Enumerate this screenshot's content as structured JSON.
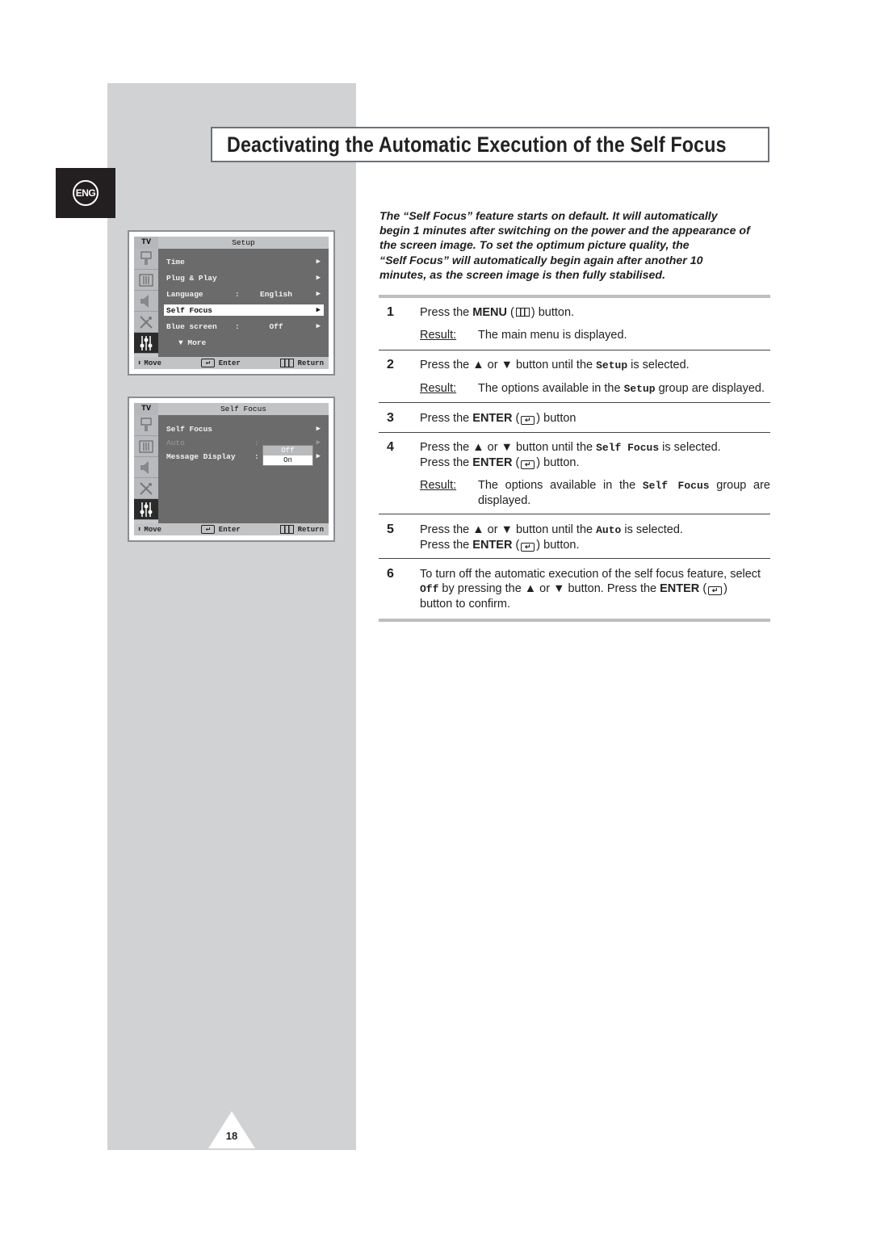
{
  "sidebar": {
    "language_badge": "ENG",
    "page_number": "18"
  },
  "header": {
    "title": "Deactivating the Automatic Execution of the Self Focus"
  },
  "screen1": {
    "tv_label": "TV",
    "title": "Setup",
    "rows": [
      {
        "label": "Time",
        "value": "",
        "arrow": "▶"
      },
      {
        "label": "Plug & Play",
        "value": "",
        "arrow": "▶"
      },
      {
        "label": "Language",
        "colon": ":",
        "value": "English",
        "arrow": "▶"
      },
      {
        "label": "Self Focus",
        "value": "",
        "arrow": "▶",
        "selected": true
      },
      {
        "label": "Blue screen",
        "colon": ":",
        "value": "Off",
        "arrow": "▶"
      },
      {
        "label": "▼ More",
        "value": ""
      }
    ],
    "footer": {
      "move": "Move",
      "enter": "Enter",
      "return": "Return"
    }
  },
  "screen2": {
    "tv_label": "TV",
    "title": "Self Focus",
    "rows": [
      {
        "label": "Self Focus",
        "arrow": "▶"
      },
      {
        "label": "Auto",
        "colon": ":",
        "arrow": "▶",
        "dimmed": true
      },
      {
        "label": "Message Display",
        "colon": ":",
        "arrow": "▶"
      }
    ],
    "dropdown": {
      "options": [
        "Off",
        "On"
      ],
      "highlighted": "Off"
    },
    "footer": {
      "move": "Move",
      "enter": "Enter",
      "return": "Return"
    }
  },
  "intro": {
    "lines": [
      "The “Self Focus” feature starts on default.  It will automatically",
      "begin 1 minutes after switching on the power and the appearance of",
      "the screen image. To set the optimum picture quality, the",
      "“Self Focus” will automatically begin again after another 10",
      "minutes, as the screen image is then fully stabilised."
    ]
  },
  "steps": [
    {
      "num": "1",
      "pre": "Press the ",
      "bold": "MENU",
      "post": " button.",
      "result_label": "Result:",
      "result": "The main menu is displayed."
    },
    {
      "num": "2",
      "pre": "Press the ▲ or ▼ button until the ",
      "code": "Setup",
      "post": " is selected.",
      "result_label": "Result:",
      "result_pre": "The options available in the ",
      "result_code": "Setup",
      "result_post": " group are displayed."
    },
    {
      "num": "3",
      "pre": "Press the ",
      "bold": "ENTER",
      "post": " button"
    },
    {
      "num": "4",
      "pre": "Press the ▲ or ▼ button until the ",
      "code": "Self Focus",
      "post": " is selected.",
      "line2_pre": "Press the ",
      "line2_bold": "ENTER",
      "line2_post": " button.",
      "result_label": "Result:",
      "result_pre": "The options available in the ",
      "result_code": "Self Focus",
      "result_post": " group are displayed."
    },
    {
      "num": "5",
      "pre": "Press the ▲ or ▼ button until the ",
      "code": "Auto",
      "post": " is selected.",
      "line2_pre": "Press the ",
      "line2_bold": "ENTER",
      "line2_post": " button."
    },
    {
      "num": "6",
      "line1": "To turn off the automatic execution of the self focus feature, select",
      "code": "Off",
      "mid": " by pressing the ▲ or ▼ button. Press the ",
      "bold": "ENTER",
      "line3": "button to confirm."
    }
  ]
}
